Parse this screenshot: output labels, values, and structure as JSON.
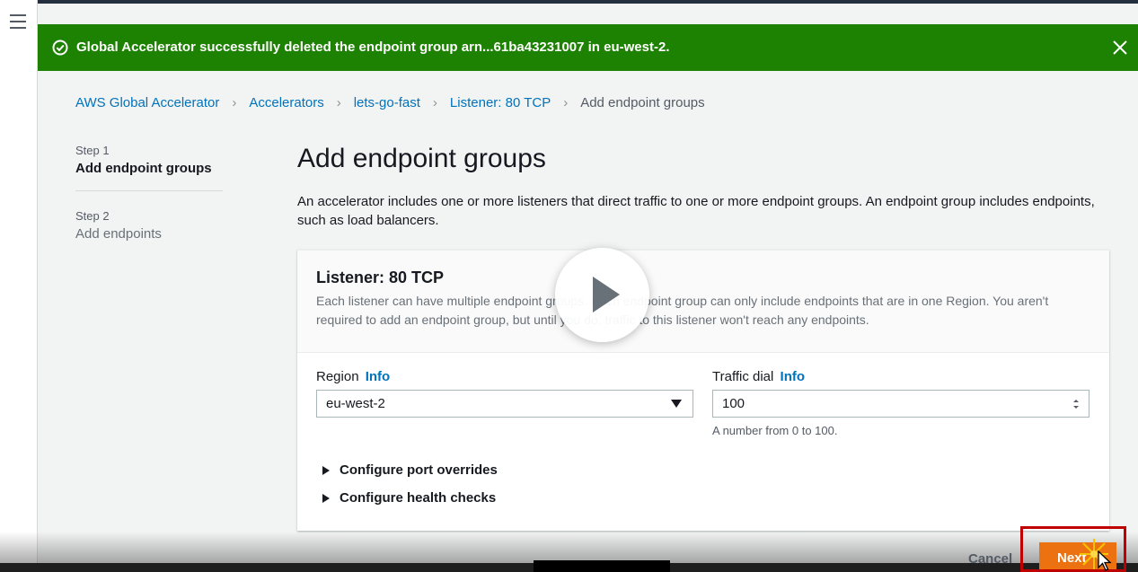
{
  "nav": {
    "menu_icon": "hamburger-menu-icon"
  },
  "flash": {
    "type": "success",
    "color": "#1d8102",
    "message": "Global Accelerator successfully deleted the endpoint group arn...61ba43231007 in eu-west-2.",
    "status_icon": "check-circle-icon",
    "dismiss_icon": "close-icon"
  },
  "breadcrumb": {
    "items": [
      "AWS Global Accelerator",
      "Accelerators",
      "lets-go-fast",
      "Listener: 80 TCP"
    ],
    "current": "Add endpoint groups",
    "separator_icon": "chevron-right-icon"
  },
  "steps": [
    {
      "number": "Step 1",
      "title": "Add endpoint groups",
      "active": true
    },
    {
      "number": "Step 2",
      "title": "Add endpoints",
      "active": false
    }
  ],
  "page": {
    "title": "Add endpoint groups",
    "description": "An accelerator includes one or more listeners that direct traffic to one or more endpoint groups. An endpoint group includes endpoints, such as load balancers."
  },
  "listener_card": {
    "title": "Listener: 80 TCP",
    "description": "Each listener can have multiple endpoint groups. Each endpoint group can only include endpoints that are in one Region. You aren't required to add an endpoint group, but until you do, traffic to this listener won't reach any endpoints.",
    "region": {
      "label": "Region",
      "info": "Info",
      "value": "eu-west-2"
    },
    "traffic_dial": {
      "label": "Traffic dial",
      "info": "Info",
      "value": "100",
      "hint": "A number from 0 to 100."
    },
    "expanders": [
      "Configure port overrides",
      "Configure health checks"
    ]
  },
  "actions": {
    "cancel": "Cancel",
    "next": "Next",
    "next_color": "#ec7211"
  },
  "video_overlay": {
    "play_icon": "play-icon",
    "caption_tab": ""
  },
  "accent_colors": {
    "link": "#0073bb",
    "highlight_box": "#c00000"
  }
}
